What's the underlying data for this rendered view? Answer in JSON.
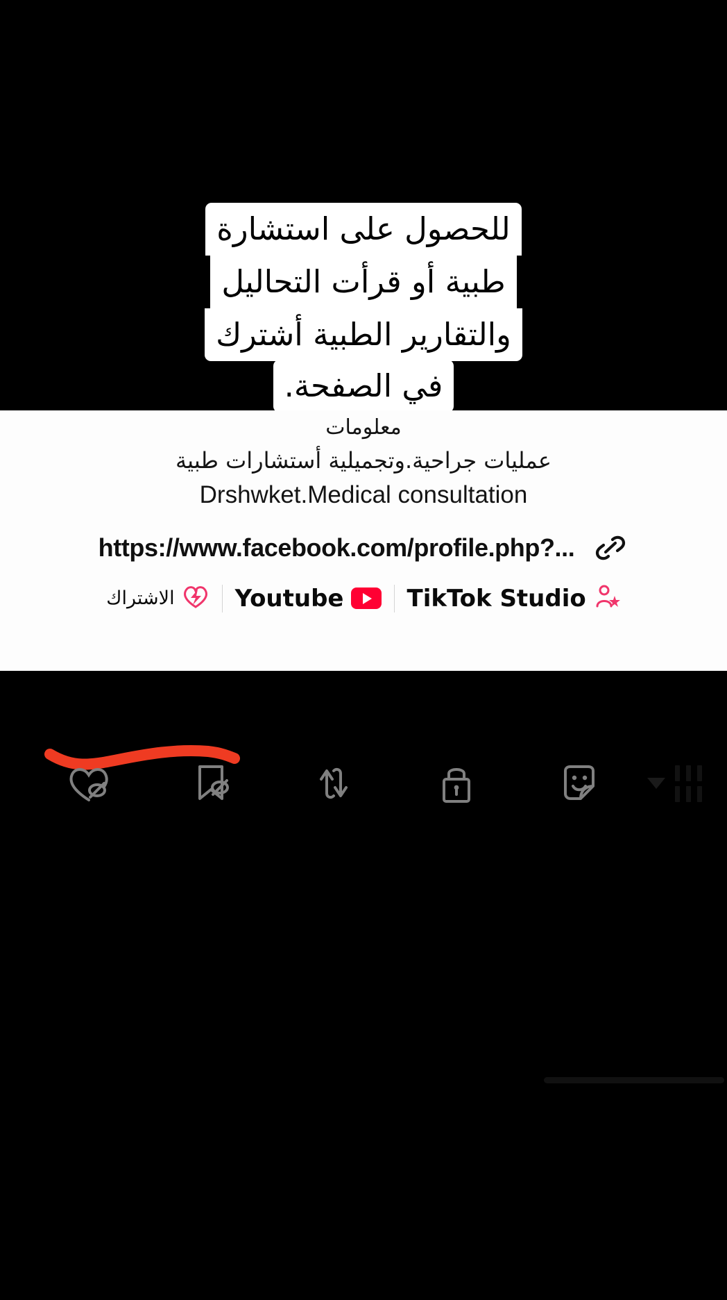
{
  "app": {
    "surface": "tiktok-video-editor-info-panel",
    "background_color": "#000000",
    "panel_color": "#fdfdfd"
  },
  "caption": {
    "lines": [
      "للحصول على استشارة",
      "طبية أو قرأت التحاليل",
      "والتقارير الطبية أشترك",
      "في الصفحة."
    ],
    "full_text": "للحصول على استشارة طبية أو قرأت التحاليل والتقارير الطبية أشترك في الصفحة."
  },
  "info_panel": {
    "heading": "معلومات",
    "bio": "عمليات جراحية.وتجميلية أستشارات طبية",
    "account_name": "Drshwket.Medical consultation",
    "url": {
      "text": "https://www.facebook.com/profile.php?...",
      "icon": "link-icon"
    }
  },
  "shortcuts": [
    {
      "label": "الاشتراك",
      "icon": "subscribe-badge-icon",
      "rtl": true
    },
    {
      "label": "Youtube",
      "icon": "youtube-icon",
      "rtl": false
    },
    {
      "label": "TikTok Studio",
      "icon": "tiktok-studio-icon",
      "rtl": false
    }
  ],
  "toolbar": {
    "items": [
      {
        "name": "hide-like-icon",
        "label": "Hide likes"
      },
      {
        "name": "hide-bookmark-icon",
        "label": "Hide saves"
      },
      {
        "name": "repost-arrows-icon",
        "label": "Repost"
      },
      {
        "name": "lock-icon",
        "label": "Privacy"
      },
      {
        "name": "sticker-icon",
        "label": "Sticker"
      },
      {
        "name": "chevron-down-icon",
        "label": "More"
      },
      {
        "name": "keyboard-bars-icon",
        "label": "Keyboard"
      }
    ]
  },
  "annotation": {
    "type": "red-scribble-underline",
    "color": "#ef3b22"
  }
}
